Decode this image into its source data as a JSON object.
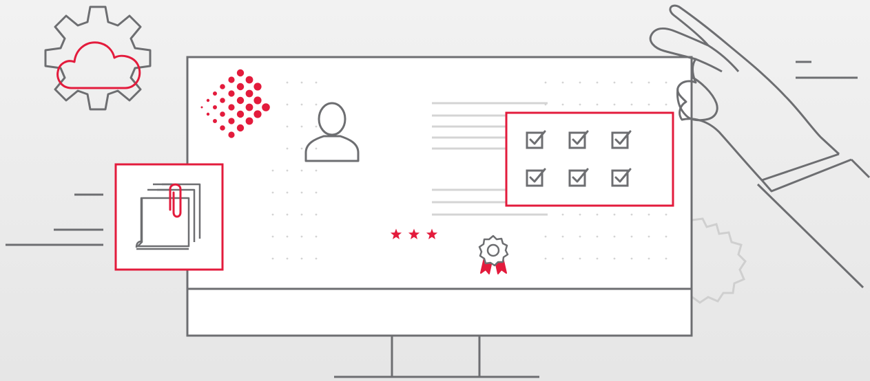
{
  "colors": {
    "background": "#efefef",
    "outline": "#6d6e71",
    "accent": "#e31b3c",
    "light_outline": "#c9c9c9",
    "text_lines": "#cfcfcf",
    "screen": "#ffffff"
  },
  "icons": [
    "gear-icon",
    "cloud-icon",
    "monitor-icon",
    "logo-dots-icon",
    "user-icon",
    "document-clip-icon",
    "checkbox-grid-icon",
    "star-icon",
    "award-badge-icon",
    "hand-icon",
    "motion-lines-icon"
  ],
  "rating": {
    "stars": 3
  },
  "checklist": {
    "checked": 6,
    "total": 6
  }
}
